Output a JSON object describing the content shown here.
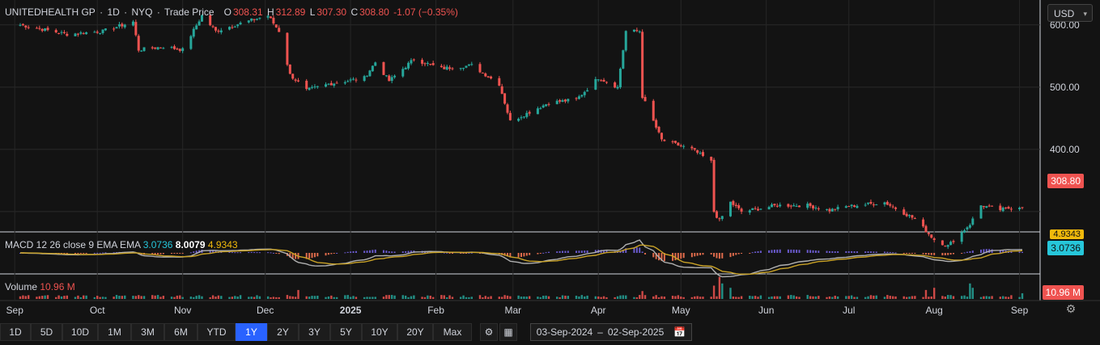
{
  "header": {
    "symbol": "UNITEDHEALTH GP",
    "interval": "1D",
    "exchange": "NYQ",
    "price_type": "Trade Price",
    "o_label": "O",
    "o_value": "308.31",
    "h_label": "H",
    "h_value": "312.89",
    "l_label": "L",
    "l_value": "307.30",
    "c_label": "C",
    "c_value": "308.80",
    "change": "-1.07 (−0.35%)"
  },
  "currency": "USD",
  "macd": {
    "label": "MACD 12 26 close 9 EMA EMA",
    "v1": "3.0736",
    "v2": "8.0079",
    "v3": "4.9343",
    "tag_top": "4.9343",
    "tag_bottom": "3.0736"
  },
  "volume": {
    "label": "Volume",
    "value": "10.96 M",
    "tag": "10.96 M"
  },
  "price_tag": "308.80",
  "range_buttons": [
    "1D",
    "5D",
    "10D",
    "1M",
    "3M",
    "6M",
    "YTD",
    "1Y",
    "2Y",
    "3Y",
    "5Y",
    "10Y",
    "20Y",
    "Max"
  ],
  "active_range": "1Y",
  "date_range": {
    "from": "03-Sep-2024",
    "sep": "–",
    "to": "02-Sep-2025"
  },
  "colors": {
    "up": "#26a69a",
    "down": "#ef5350",
    "macd": "#b0b0b0",
    "signal": "#c9a227",
    "active": "#2962ff"
  },
  "chart_data": {
    "type": "candlestick",
    "y_ticks": [
      "600.00",
      "500.00",
      "400.00"
    ],
    "ylim": [
      270,
      640
    ],
    "x_ticks": [
      {
        "label": "Sep",
        "date": "2024-09-01"
      },
      {
        "label": "Oct",
        "date": "2024-10-01"
      },
      {
        "label": "Nov",
        "date": "2024-11-01"
      },
      {
        "label": "Dec",
        "date": "2024-12-01"
      },
      {
        "label": "2025",
        "date": "2025-01-01"
      },
      {
        "label": "Feb",
        "date": "2025-02-01"
      },
      {
        "label": "Mar",
        "date": "2025-03-01"
      },
      {
        "label": "Apr",
        "date": "2025-04-01"
      },
      {
        "label": "May",
        "date": "2025-05-01"
      },
      {
        "label": "Jun",
        "date": "2025-06-01"
      },
      {
        "label": "Jul",
        "date": "2025-07-01"
      },
      {
        "label": "Aug",
        "date": "2025-08-01"
      },
      {
        "label": "Sep",
        "date": "2025-09-01"
      }
    ],
    "x_range": [
      "2024-08-29",
      "2025-09-02"
    ],
    "close_path": [
      [
        "2024-09-03",
        600
      ],
      [
        "2024-09-20",
        585
      ],
      [
        "2024-10-03",
        590
      ],
      [
        "2024-10-14",
        605
      ],
      [
        "2024-10-16",
        560
      ],
      [
        "2024-10-25",
        565
      ],
      [
        "2024-11-01",
        560
      ],
      [
        "2024-11-08",
        615
      ],
      [
        "2024-11-13",
        590
      ],
      [
        "2024-11-20",
        600
      ],
      [
        "2024-12-02",
        615
      ],
      [
        "2024-12-06",
        590
      ],
      [
        "2024-12-10",
        520
      ],
      [
        "2024-12-16",
        495
      ],
      [
        "2024-12-24",
        505
      ],
      [
        "2025-01-06",
        515
      ],
      [
        "2025-01-10",
        540
      ],
      [
        "2025-01-15",
        510
      ],
      [
        "2025-01-24",
        545
      ],
      [
        "2025-02-03",
        530
      ],
      [
        "2025-02-14",
        535
      ],
      [
        "2025-02-24",
        505
      ],
      [
        "2025-02-28",
        445
      ],
      [
        "2025-03-14",
        475
      ],
      [
        "2025-03-24",
        480
      ],
      [
        "2025-04-01",
        515
      ],
      [
        "2025-04-08",
        500
      ],
      [
        "2025-04-11",
        590
      ],
      [
        "2025-04-16",
        590
      ],
      [
        "2025-04-17",
        485
      ],
      [
        "2025-04-24",
        415
      ],
      [
        "2025-05-05",
        400
      ],
      [
        "2025-05-12",
        380
      ],
      [
        "2025-05-13",
        300
      ],
      [
        "2025-05-15",
        285
      ],
      [
        "2025-05-19",
        315
      ],
      [
        "2025-05-23",
        300
      ],
      [
        "2025-06-05",
        310
      ],
      [
        "2025-06-16",
        310
      ],
      [
        "2025-06-24",
        302
      ],
      [
        "2025-06-30",
        308
      ],
      [
        "2025-07-14",
        315
      ],
      [
        "2025-07-25",
        288
      ],
      [
        "2025-08-01",
        255
      ],
      [
        "2025-08-06",
        245
      ],
      [
        "2025-08-14",
        280
      ],
      [
        "2025-08-18",
        310
      ],
      [
        "2025-08-25",
        303
      ],
      [
        "2025-09-02",
        308.8
      ]
    ],
    "volume_spikes": [
      [
        "2024-12-13",
        3
      ],
      [
        "2025-04-17",
        2.5
      ],
      [
        "2025-05-13",
        5
      ],
      [
        "2025-05-15",
        9
      ],
      [
        "2025-05-16",
        6
      ],
      [
        "2025-05-19",
        4
      ],
      [
        "2025-07-29",
        3
      ],
      [
        "2025-08-01",
        4
      ],
      [
        "2025-08-14",
        6
      ],
      [
        "2025-08-15",
        4
      ],
      [
        "2025-09-02",
        1.5
      ]
    ]
  }
}
